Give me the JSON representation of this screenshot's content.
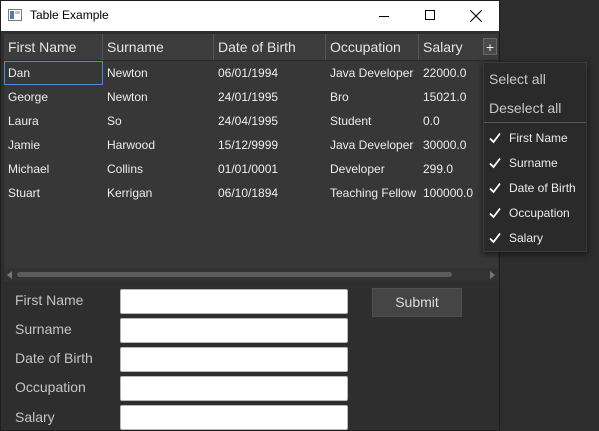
{
  "window": {
    "title": "Table Example"
  },
  "table": {
    "columns": [
      "First Name",
      "Surname",
      "Date of Birth",
      "Occupation",
      "Salary"
    ],
    "add_column_glyph": "+",
    "rows": [
      [
        "Dan",
        "Newton",
        "06/01/1994",
        "Java Developer",
        "22000.0"
      ],
      [
        "George",
        "Newton",
        "24/01/1995",
        "Bro",
        "15021.0"
      ],
      [
        "Laura",
        "So",
        "24/04/1995",
        "Student",
        "0.0"
      ],
      [
        "Jamie",
        "Harwood",
        "15/12/9999",
        "Java Developer",
        "30000.0"
      ],
      [
        "Michael",
        "Collins",
        "01/01/0001",
        "Developer",
        "299.0"
      ],
      [
        "Stuart",
        "Kerrigan",
        "06/10/1894",
        "Teaching Fellow",
        "100000.0"
      ]
    ]
  },
  "column_menu": {
    "select_all": "Select all",
    "deselect_all": "Deselect all",
    "items": [
      {
        "label": "First Name",
        "checked": true
      },
      {
        "label": "Surname",
        "checked": true
      },
      {
        "label": "Date of Birth",
        "checked": true
      },
      {
        "label": "Occupation",
        "checked": true
      },
      {
        "label": "Salary",
        "checked": true
      }
    ]
  },
  "form": {
    "labels": [
      "First Name",
      "Surname",
      "Date of Birth",
      "Occupation",
      "Salary"
    ],
    "values": [
      "",
      "",
      "",
      "",
      ""
    ],
    "submit_label": "Submit"
  }
}
